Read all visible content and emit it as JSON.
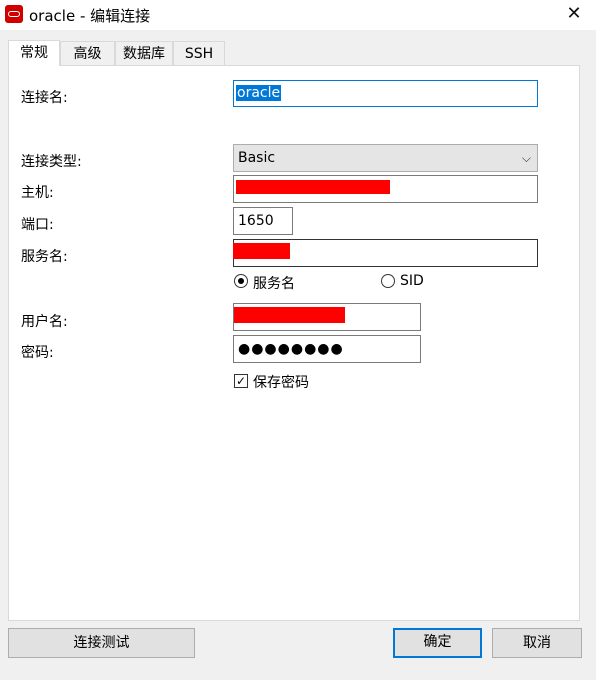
{
  "window": {
    "title": "oracle - 编辑连接",
    "close_glyph": "✕"
  },
  "tabs": [
    {
      "label": "常规",
      "active": true
    },
    {
      "label": "高级",
      "active": false
    },
    {
      "label": "数据库",
      "active": false
    },
    {
      "label": "SSH",
      "active": false
    }
  ],
  "form": {
    "connection_name_label": "连接名:",
    "connection_name_value": "oracle",
    "connection_type_label": "连接类型:",
    "connection_type_value": "Basic",
    "host_label": "主机:",
    "port_label": "端口:",
    "port_value": "1650",
    "service_name_label": "服务名:",
    "radio_service_name": "服务名",
    "radio_sid": "SID",
    "username_label": "用户名:",
    "password_label": "密码:",
    "password_masked": "●●●●●●●●",
    "save_password_label": "保存密码",
    "save_password_checked": true
  },
  "buttons": {
    "test_connection": "连接测试",
    "ok": "确定",
    "cancel": "取消"
  },
  "colors": {
    "accent": "#0078d7",
    "redaction": "#ff0000",
    "brand": "#d00000"
  }
}
